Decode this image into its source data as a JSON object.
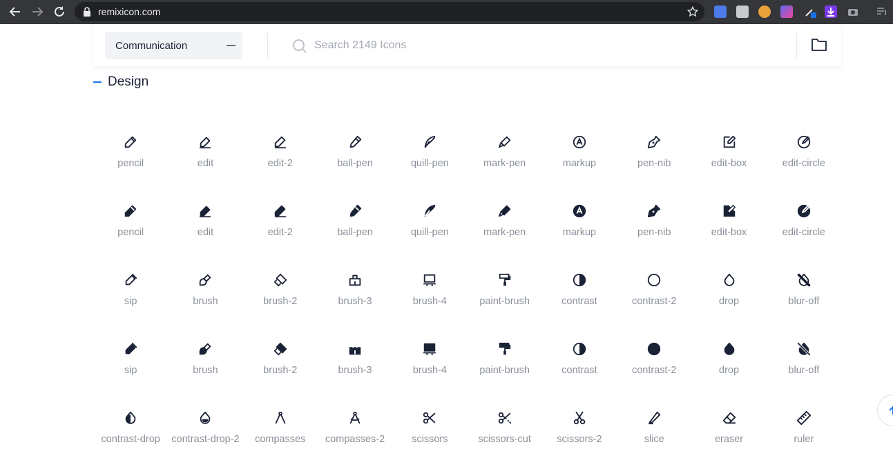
{
  "browser": {
    "url": "remixicon.com",
    "colors": {
      "chrome": "#35363a",
      "omnibox": "#202124",
      "text": "#e8eaed"
    },
    "extensions": [
      {
        "icon": "translate-ext-icon",
        "color": "#4d7be9"
      },
      {
        "icon": "diamond-ext-icon",
        "color": "#c9cacc"
      },
      {
        "icon": "owl-ext-icon",
        "color": "#e8a23a"
      },
      {
        "icon": "grid-ext-icon",
        "color": "#8b5cf6"
      },
      {
        "icon": "dropper-ext-icon",
        "color": "#1a73e8"
      },
      {
        "icon": "download-ext-icon",
        "color": "#7c3aed"
      },
      {
        "icon": "camera-ext-icon",
        "color": "#9aa0a6"
      },
      {
        "icon": "playlist-ext-icon",
        "color": "#9aa0a6"
      }
    ]
  },
  "toolbar": {
    "category": "Communication",
    "search_placeholder": "Search 2149 Icons",
    "icons": {
      "search": "search-icon",
      "folder": "folder-icon",
      "collapse": "minus-icon"
    }
  },
  "section": {
    "title": "Design",
    "accent": "#1a73e8"
  },
  "icons": [
    {
      "label": "pencil",
      "glyph": "pencil",
      "style": "line"
    },
    {
      "label": "edit",
      "glyph": "edit",
      "style": "line"
    },
    {
      "label": "edit-2",
      "glyph": "edit2",
      "style": "line"
    },
    {
      "label": "ball-pen",
      "glyph": "ballpen",
      "style": "line"
    },
    {
      "label": "quill-pen",
      "glyph": "quill",
      "style": "line"
    },
    {
      "label": "mark-pen",
      "glyph": "markpen",
      "style": "line"
    },
    {
      "label": "markup",
      "glyph": "markup",
      "style": "line"
    },
    {
      "label": "pen-nib",
      "glyph": "pennib",
      "style": "line"
    },
    {
      "label": "edit-box",
      "glyph": "editbox",
      "style": "line"
    },
    {
      "label": "edit-circle",
      "glyph": "editcircle",
      "style": "line"
    },
    {
      "label": "pencil",
      "glyph": "pencil",
      "style": "fill"
    },
    {
      "label": "edit",
      "glyph": "edit",
      "style": "fill"
    },
    {
      "label": "edit-2",
      "glyph": "edit2",
      "style": "fill"
    },
    {
      "label": "ball-pen",
      "glyph": "ballpen",
      "style": "fill"
    },
    {
      "label": "quill-pen",
      "glyph": "quill",
      "style": "fill"
    },
    {
      "label": "mark-pen",
      "glyph": "markpen",
      "style": "fill"
    },
    {
      "label": "markup",
      "glyph": "markup",
      "style": "fill"
    },
    {
      "label": "pen-nib",
      "glyph": "pennib",
      "style": "fill"
    },
    {
      "label": "edit-box",
      "glyph": "editbox",
      "style": "fill"
    },
    {
      "label": "edit-circle",
      "glyph": "editcircle",
      "style": "fill"
    },
    {
      "label": "sip",
      "glyph": "sip",
      "style": "line"
    },
    {
      "label": "brush",
      "glyph": "brush",
      "style": "line"
    },
    {
      "label": "brush-2",
      "glyph": "brush2",
      "style": "line"
    },
    {
      "label": "brush-3",
      "glyph": "brush3",
      "style": "line"
    },
    {
      "label": "brush-4",
      "glyph": "brush4",
      "style": "line"
    },
    {
      "label": "paint-brush",
      "glyph": "paintbrush",
      "style": "line"
    },
    {
      "label": "contrast",
      "glyph": "contrast",
      "style": "line"
    },
    {
      "label": "contrast-2",
      "glyph": "contrast2",
      "style": "line"
    },
    {
      "label": "drop",
      "glyph": "drop",
      "style": "line"
    },
    {
      "label": "blur-off",
      "glyph": "bluroff",
      "style": "line"
    },
    {
      "label": "sip",
      "glyph": "sip",
      "style": "fill"
    },
    {
      "label": "brush",
      "glyph": "brush",
      "style": "fill"
    },
    {
      "label": "brush-2",
      "glyph": "brush2",
      "style": "fill"
    },
    {
      "label": "brush-3",
      "glyph": "brush3",
      "style": "fill"
    },
    {
      "label": "brush-4",
      "glyph": "brush4",
      "style": "fill"
    },
    {
      "label": "paint-brush",
      "glyph": "paintbrush",
      "style": "fill"
    },
    {
      "label": "contrast",
      "glyph": "contrast",
      "style": "fill"
    },
    {
      "label": "contrast-2",
      "glyph": "contrast2",
      "style": "fill"
    },
    {
      "label": "drop",
      "glyph": "drop",
      "style": "fill"
    },
    {
      "label": "blur-off",
      "glyph": "bluroff",
      "style": "fill"
    },
    {
      "label": "contrast-drop",
      "glyph": "contrastdrop",
      "style": "line"
    },
    {
      "label": "contrast-drop-2",
      "glyph": "contrastdrop2",
      "style": "line"
    },
    {
      "label": "compasses",
      "glyph": "compasses",
      "style": "line"
    },
    {
      "label": "compasses-2",
      "glyph": "compasses2",
      "style": "line"
    },
    {
      "label": "scissors",
      "glyph": "scissors",
      "style": "line"
    },
    {
      "label": "scissors-cut",
      "glyph": "scissorscut",
      "style": "line"
    },
    {
      "label": "scissors-2",
      "glyph": "scissors2",
      "style": "line"
    },
    {
      "label": "slice",
      "glyph": "slice",
      "style": "line"
    },
    {
      "label": "eraser",
      "glyph": "eraser",
      "style": "line"
    },
    {
      "label": "ruler",
      "glyph": "ruler",
      "style": "line"
    }
  ],
  "colors": {
    "icon": "#1a2236",
    "label": "#8a909a"
  }
}
